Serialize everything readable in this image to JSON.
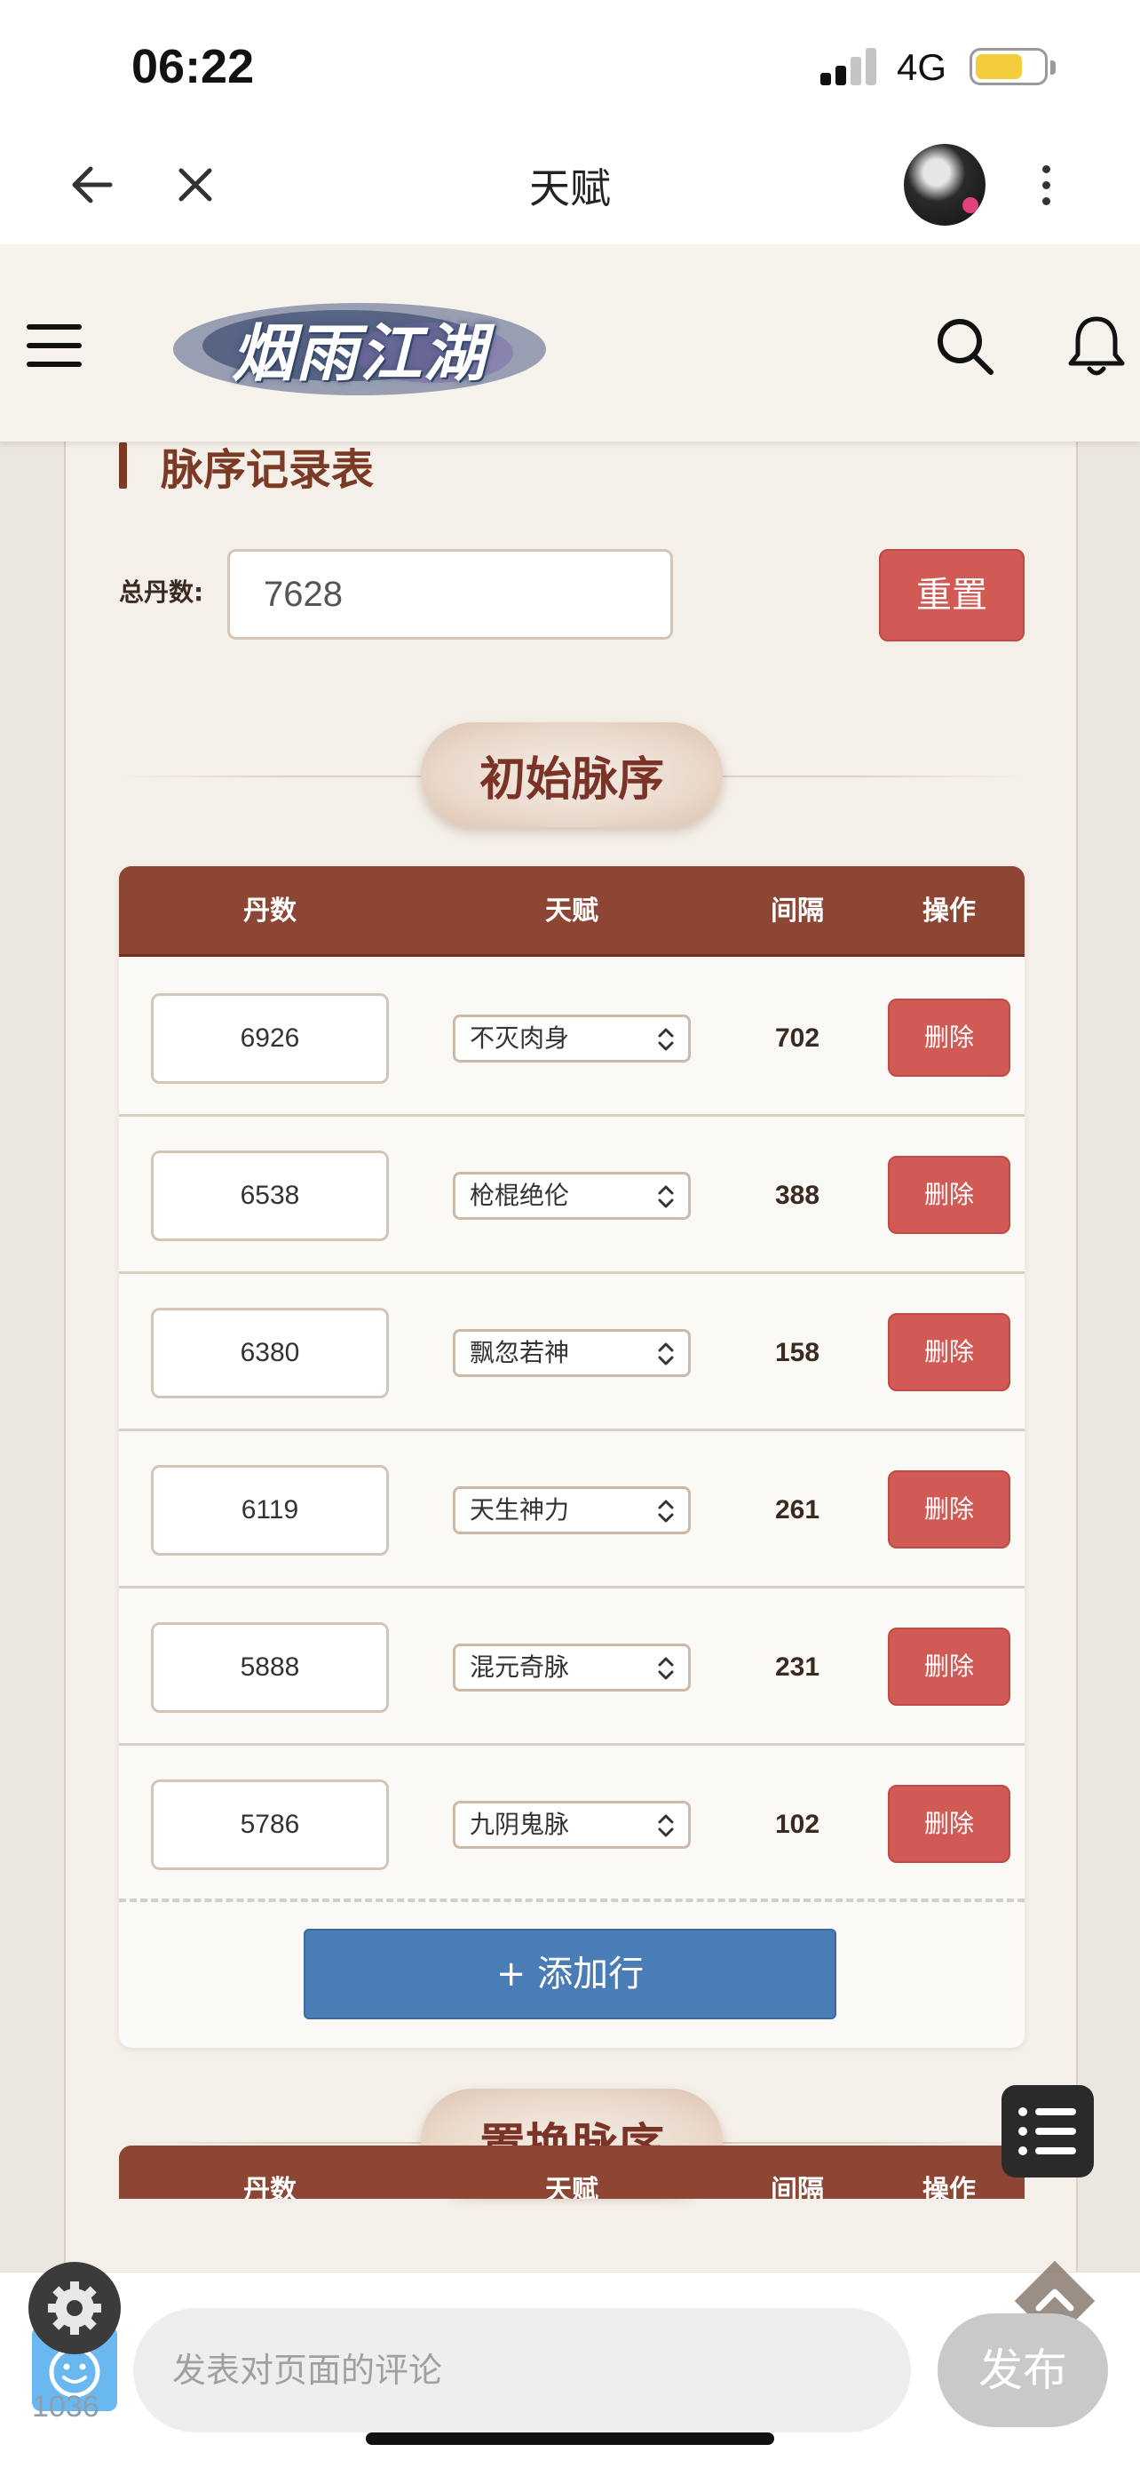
{
  "status_bar": {
    "time": "06:22",
    "network": "4G"
  },
  "nav": {
    "title": "天赋"
  },
  "site": {
    "logo_text": "烟雨江湖"
  },
  "panel": {
    "section_title": "脉序记录表",
    "total_label": "总丹数:",
    "total_value": "7628",
    "reset_label": "重置",
    "initial_heading": "初始脉序",
    "swap_heading": "置换脉序",
    "columns": [
      "丹数",
      "天赋",
      "间隔",
      "操作"
    ],
    "rows": [
      {
        "dan": "6926",
        "talent": "不灭肉身",
        "gap": "702",
        "action": "删除"
      },
      {
        "dan": "6538",
        "talent": "枪棍绝伦",
        "gap": "388",
        "action": "删除"
      },
      {
        "dan": "6380",
        "talent": "飘忽若神",
        "gap": "158",
        "action": "删除"
      },
      {
        "dan": "6119",
        "talent": "天生神力",
        "gap": "261",
        "action": "删除"
      },
      {
        "dan": "5888",
        "talent": "混元奇脉",
        "gap": "231",
        "action": "删除"
      },
      {
        "dan": "5786",
        "talent": "九阴鬼脉",
        "gap": "102",
        "action": "删除"
      }
    ],
    "add_row_label": "+ 添加行"
  },
  "comment": {
    "placeholder": "发表对页面的评论",
    "publish_label": "发布",
    "counter": "1036"
  },
  "colors": {
    "header_brown": "#8d4634",
    "title_brown": "#7a3a26",
    "danger_red": "#d15a55",
    "add_blue": "#4a7db5",
    "page_bg": "#ece7de"
  }
}
